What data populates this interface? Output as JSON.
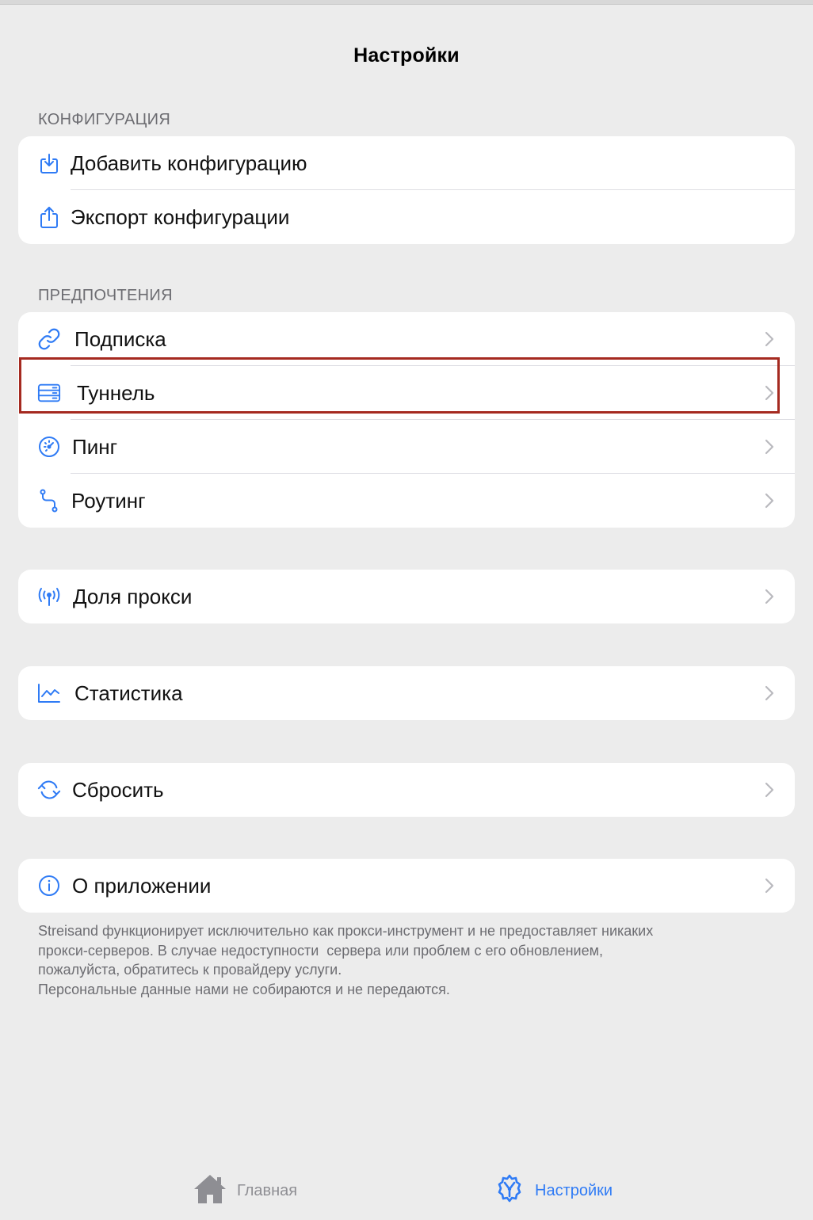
{
  "nav": {
    "title": "Настройки"
  },
  "sections": {
    "config": {
      "header": "КОНФИГУРАЦИЯ",
      "items": [
        {
          "label": "Добавить конфигурацию",
          "icon": "download-tray-icon"
        },
        {
          "label": "Экспорт конфигурации",
          "icon": "share-icon"
        }
      ]
    },
    "prefs": {
      "header": "ПРЕДПОЧТЕНИЯ",
      "items": [
        {
          "label": "Подписка",
          "icon": "link-icon"
        },
        {
          "label": "Туннель",
          "icon": "server-rack-icon"
        },
        {
          "label": "Пинг",
          "icon": "gauge-icon"
        },
        {
          "label": "Роутинг",
          "icon": "route-icon"
        }
      ]
    },
    "share": {
      "items": [
        {
          "label": "Доля прокси",
          "icon": "antenna-icon"
        }
      ]
    },
    "stats": {
      "items": [
        {
          "label": "Статистика",
          "icon": "chart-icon"
        }
      ]
    },
    "reset": {
      "items": [
        {
          "label": "Сбросить",
          "icon": "reset-icon"
        }
      ]
    },
    "about": {
      "items": [
        {
          "label": "О приложении",
          "icon": "info-icon"
        }
      ]
    }
  },
  "footer": {
    "lines": [
      "Streisand функционирует исключительно как прокси-инструмент и не предоставляет никаких",
      "прокси-серверов. В случае недоступности  сервера или проблем с его обновлением,",
      "пожалуйста, обратитесь к провайдеру услуги.",
      "Персональные данные нами не собираются и не передаются."
    ]
  },
  "tabbar": {
    "home": {
      "label": "Главная",
      "icon": "house-icon",
      "color": "#8e8e93"
    },
    "settings": {
      "label": "Настройки",
      "icon": "gear-icon",
      "color": "#2f7bf5",
      "selected": true
    }
  },
  "colors": {
    "accent": "#2f7bf5",
    "highlight": "#a52a20"
  }
}
